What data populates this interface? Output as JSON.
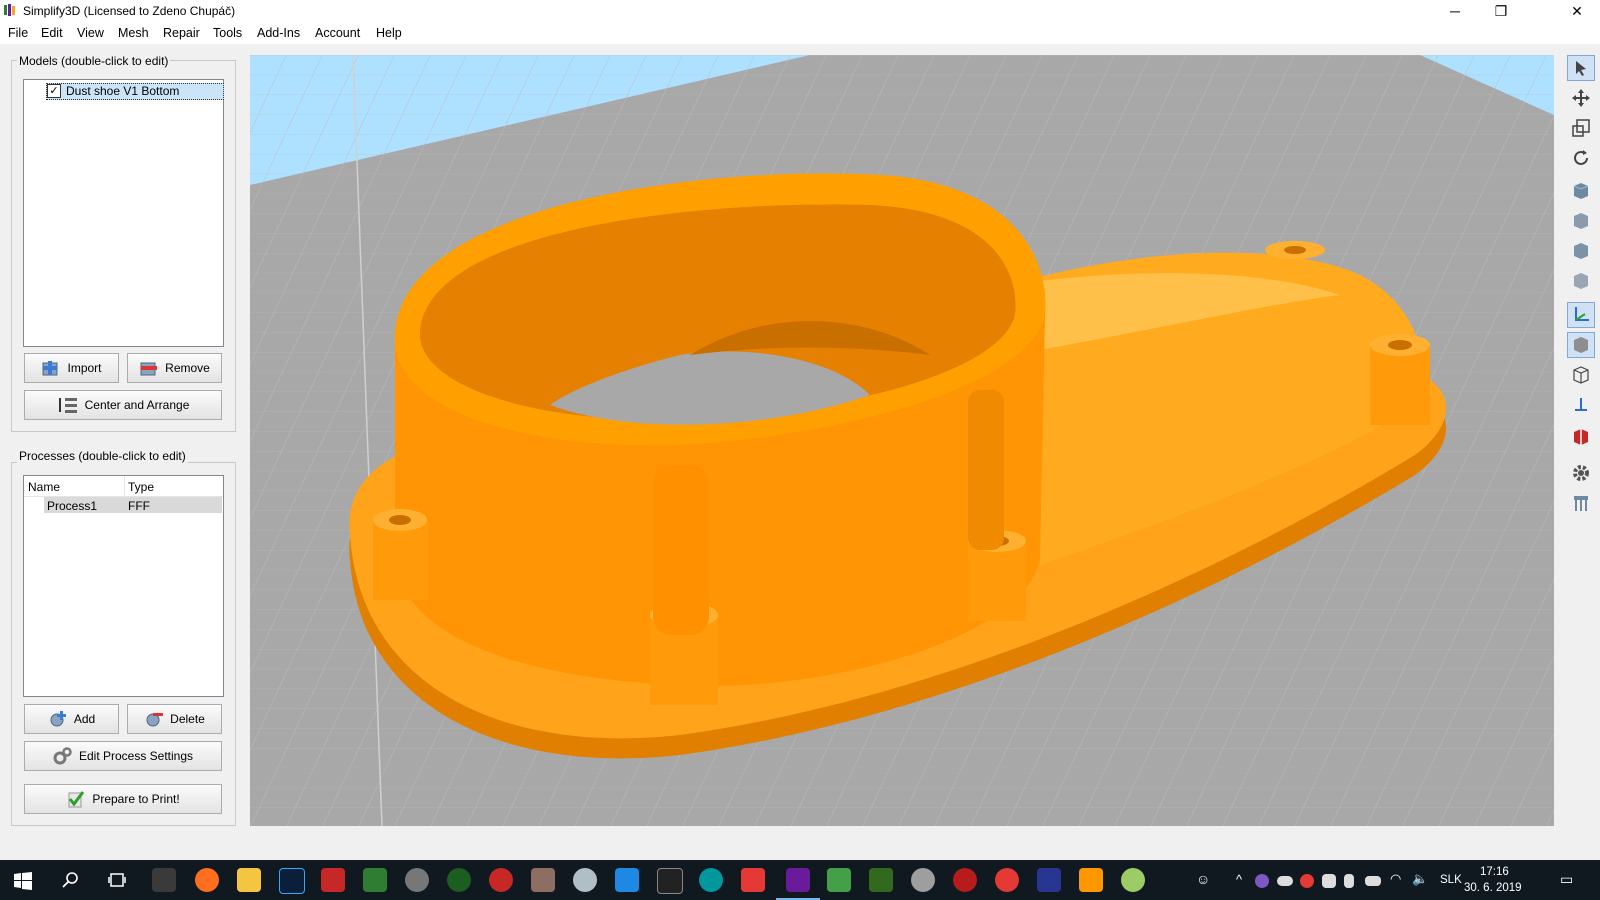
{
  "window": {
    "title": "Simplify3D (Licensed to Zdeno Chupáč)",
    "controls": {
      "minimize": "─",
      "maximize": "❐",
      "close": "✕"
    }
  },
  "menu": [
    "File",
    "Edit",
    "View",
    "Mesh",
    "Repair",
    "Tools",
    "Add-Ins",
    "Account",
    "Help"
  ],
  "models": {
    "title": "Models (double-click to edit)",
    "items": [
      {
        "label": "Dust shoe V1 Bottom",
        "checked": true
      }
    ],
    "import_label": "Import",
    "remove_label": "Remove",
    "arrange_label": "Center and Arrange"
  },
  "processes": {
    "title": "Processes (double-click to edit)",
    "columns": [
      "Name",
      "Type"
    ],
    "rows": [
      {
        "name": "Process1",
        "type": "FFF"
      }
    ],
    "add_label": "Add",
    "delete_label": "Delete",
    "edit_label": "Edit Process Settings",
    "prepare_label": "Prepare to Print!"
  },
  "toolbar_icons": [
    "select-arrow-icon",
    "move-icon",
    "scale-icon",
    "rotate-icon",
    "view-iso-icon",
    "view-front-icon",
    "view-top-icon",
    "view-side-icon",
    "axes-icon",
    "solid-view-icon",
    "wireframe-icon",
    "z-axis-icon",
    "cross-section-icon",
    "settings-gear-icon",
    "supports-icon"
  ],
  "colors": {
    "model": "#ff9900",
    "sky": "#aee0ff",
    "bed": "#a8a8a8",
    "taskbar": "#101820"
  },
  "tray": {
    "language": "SLK",
    "time": "17:16",
    "date": "30. 6. 2019"
  }
}
